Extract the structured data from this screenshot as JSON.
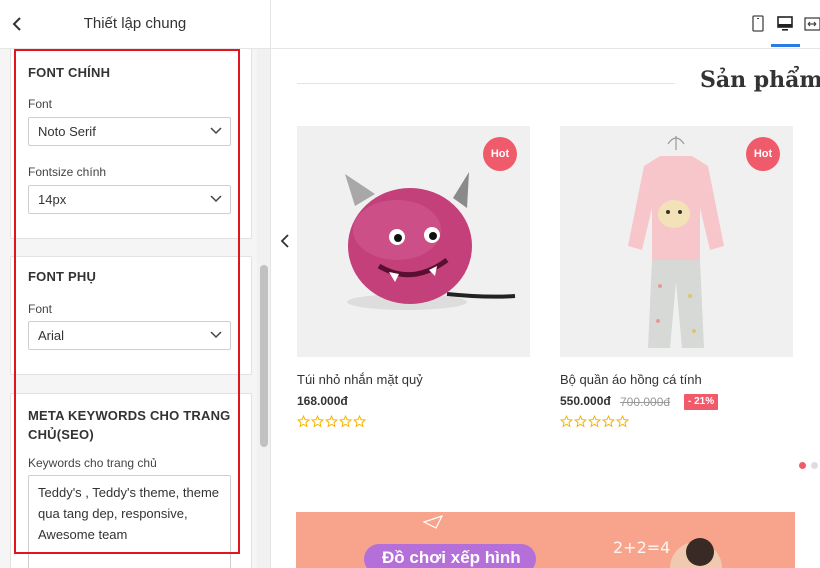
{
  "panel": {
    "title": "Thiết lập chung",
    "sections": [
      {
        "title": "FONT CHÍNH",
        "fields": [
          {
            "label": "Font",
            "value": "Noto Serif"
          },
          {
            "label": "Fontsize chính",
            "value": "14px"
          }
        ]
      },
      {
        "title": "FONT PHỤ",
        "fields": [
          {
            "label": "Font",
            "value": "Arial"
          }
        ]
      },
      {
        "title_line1": "META KEYWORDS CHO TRANG",
        "title_line2": "CHỦ(SEO)",
        "keywords_label": "Keywords cho trang chủ",
        "keywords_value": "Teddy's , Teddy's theme, theme qua tang dep, responsive, Awesome team"
      }
    ]
  },
  "preview": {
    "section_heading": "Sản phẩm H",
    "products": [
      {
        "badge": "Hot",
        "name": "Túi nhỏ nhắn mặt quỷ",
        "price": "168.000đ",
        "old_price": "",
        "discount": "",
        "rating": 0
      },
      {
        "badge": "Hot",
        "name": "Bộ quần áo hồng cá tính",
        "price": "550.000đ",
        "old_price": "700.000đ",
        "discount": "- 21%",
        "rating": 0
      }
    ],
    "banner": {
      "text": "Đồ chơi xếp hình",
      "math": "2+2=4"
    }
  },
  "colors": {
    "accent": "#2c7be5",
    "badge": "#ef5b6a",
    "highlight": "#e3131f",
    "star": "#f5b301",
    "banner": "#f8a48d"
  }
}
